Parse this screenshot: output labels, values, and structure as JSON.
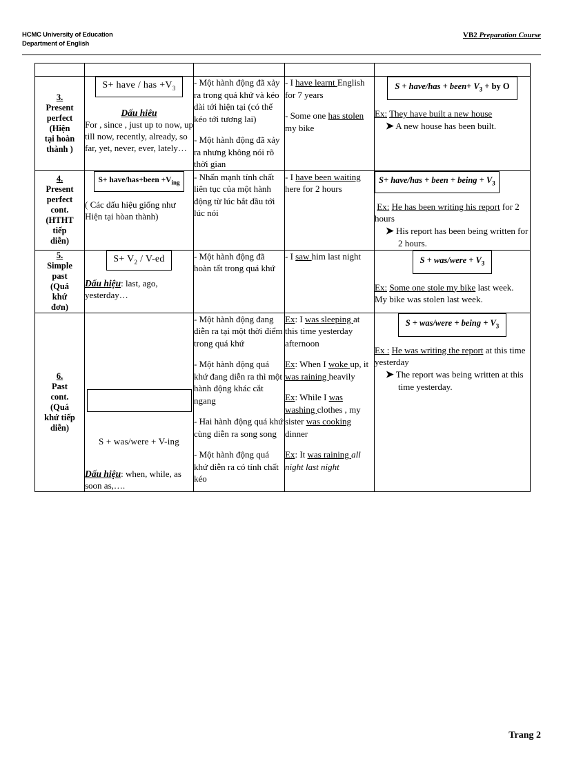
{
  "header": {
    "line1": "HCMC University of Education",
    "line2": "Department of English",
    "right_bold": "VB2",
    "right_italic": " Preparation  Course "
  },
  "footer": {
    "page_label": "Trang  2"
  },
  "table": {
    "rows": [
      {
        "number": "3.",
        "name_en_1": "Present",
        "name_en_2": "perfect",
        "name_vi_1": "(Hiện",
        "name_vi_2": "tại hoàn",
        "name_vi_3": "thành )",
        "formula": "S+ have  /  has  +V",
        "formula_sub": "3",
        "signals_label": "Dấu hiêu",
        "signals_text": "For  ,   since   ,  just up to now, up till now, recently, already,  so far, yet, never, ever, lately…",
        "uses": [
          "- Một hành động đã xảy ra trong quá khứ và kéo dài tới hiện tại (có thể kéo tới tương lai)",
          "- Một hành động đã xảy ra nhưng không nói rõ thời gian"
        ],
        "examples": [
          {
            "pre": "- I ",
            "u1": "have learnt ",
            "post": "English  for 7 years"
          },
          {
            "pre": "- Some one ",
            "u1": "has stolen ",
            "post": "my bike"
          }
        ],
        "passive_formula": "S + have/has + been+ V",
        "passive_formula_sub": "3",
        "passive_formula_tail": "  + by O",
        "passive_ex_label": "Ex:",
        "passive_ex_active_u1": "They ",
        "passive_ex_active_u2": "have built ",
        "passive_ex_active_u3": "a new house ",
        "passive_ex_result": "A new house has been built."
      },
      {
        "number": "4.",
        "name_en_1": "Present",
        "name_en_2": "perfect",
        "name_en_3": "cont.",
        "name_vi_1": "(HTHT",
        "name_vi_2": "tiếp",
        "name_vi_3": "diễn)",
        "formula": "S+ have/has+been  +V",
        "formula_sub": "ing",
        "signals_text": "( Các dấu hiệu giống như Hiện tại hòan thành)",
        "uses": [
          "- Nhấn mạnh tính chất liên tục của một hành động từ lúc bắt đầu tới lúc nói"
        ],
        "examples": [
          {
            "pre": "- I ",
            "u1": "have been waiting ",
            "post": "here for 2 hours"
          }
        ],
        "passive_formula": "S+ have/has + been + being + V",
        "passive_formula_sub": "3",
        "passive_ex_label": "Ex:",
        "passive_ex_active_u1": "He ",
        "passive_ex_active_u2": "has been writing ",
        "passive_ex_active_u3": "his report",
        "passive_ex_active_tail": " for 2 hours",
        "passive_ex_result": "His report has been being written for 2 hours."
      },
      {
        "number": "5.",
        "name_en_1": "Simple",
        "name_en_2": "past",
        "name_vi_1": "(Quá",
        "name_vi_2": "khứ",
        "name_vi_3": "đơn)",
        "formula": "S+ V",
        "formula_sub": "2",
        "formula_tail": " / V-ed",
        "signals_label": "Dấu hiệu",
        "signals_text": ": last, ago, yesterday…",
        "uses": [
          "- Một hành động đã hoàn tất trong quá khứ"
        ],
        "examples": [
          {
            "pre": "- I ",
            "u1": "saw ",
            "post": "him  last night"
          }
        ],
        "passive_formula": "S + was/were + V",
        "passive_formula_sub": "3",
        "passive_ex_label": "Ex:",
        "passive_ex_active_u1": "Some one ",
        "passive_ex_active_u2": "stole ",
        "passive_ex_active_u3": "my bike",
        "passive_ex_active_tail": " last week.",
        "passive_ex_result_plain": "My bike was stolen last week."
      },
      {
        "number": "6.",
        "name_en_1": "Past",
        "name_en_2": "cont.",
        "name_vi_1": "(Quá",
        "name_vi_2": "khứ tiếp",
        "name_vi_3": "diễn)",
        "formula": "",
        "plain_formula": "S + was/were + V-ing",
        "signals_label": "Dấu hiệu",
        "signals_text": ": when, while, as soon as,….",
        "uses": [
          "- Một hành động đang diễn ra tại một thời điểm trong quá khứ",
          "- Một hành động quá khứ đang diễn ra thì một hành động khác cắt ngang",
          "- Hai hành động quá khứ cùng diễn ra song song",
          "- Một hành động quá khứ diễn ra có tính chất kéo"
        ],
        "examples": [
          {
            "label": "Ex",
            "pre": ": I ",
            "u1": "was sleeping ",
            "post": "at this time yesterday afternoon"
          },
          {
            "label": "Ex",
            "pre": ": When I ",
            "u1": "woke ",
            "mid": "up, it ",
            "u2": "was raining ",
            "post": "heavily"
          },
          {
            "label": "Ex",
            "pre": ": While I ",
            "u1": "was washing ",
            "mid": "clothes , my sister ",
            "u2": "was cooking ",
            "post": "dinner"
          },
          {
            "label": "Ex",
            "pre": ": It ",
            "u1": "was raining ",
            "post_italic": "all night last night"
          }
        ],
        "passive_formula": "S + was/were + being + V",
        "passive_formula_sub": "3",
        "passive_ex_label": "Ex :",
        "passive_ex_active_u1": "He ",
        "passive_ex_active_u2": "was writing ",
        "passive_ex_active_u3": "the report",
        "passive_ex_active_tail": " at this time yesterday",
        "passive_ex_result": "The report was being written at this time yesterday."
      }
    ]
  }
}
